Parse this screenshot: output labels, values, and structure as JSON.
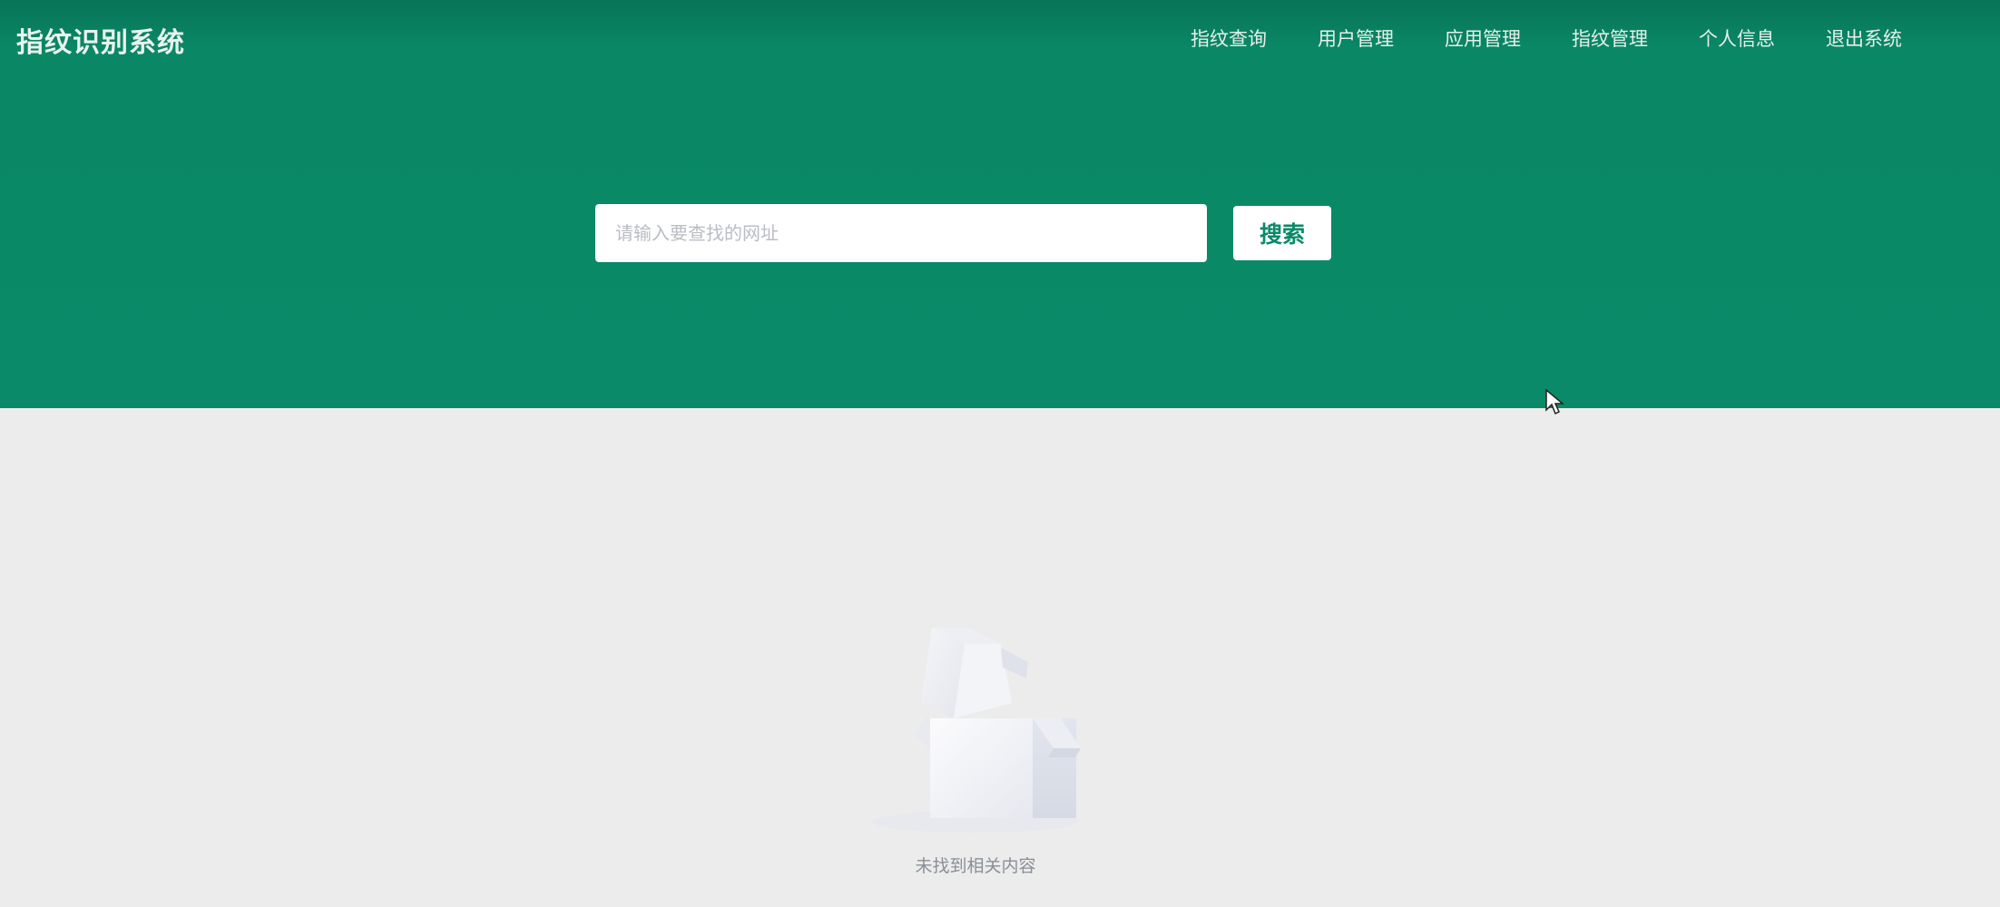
{
  "brand": {
    "title": "指纹识别系统"
  },
  "nav": {
    "items": [
      "指纹查询",
      "用户管理",
      "应用管理",
      "指纹管理",
      "个人信息",
      "退出系统"
    ]
  },
  "search": {
    "placeholder": "请输入要查找的网址",
    "value": "",
    "button_label": "搜索"
  },
  "empty_state": {
    "icon": "empty-box-icon",
    "message": "未找到相关内容"
  },
  "colors": {
    "primary": "#0a8a68",
    "header_dark": "#087458",
    "background": "#ececec"
  }
}
